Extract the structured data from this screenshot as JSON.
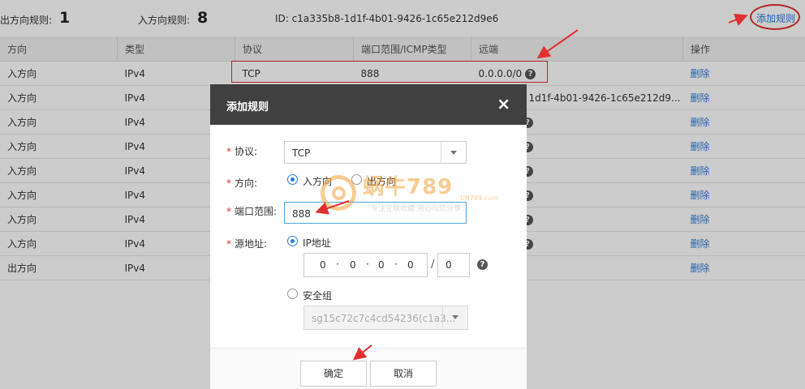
{
  "summary": {
    "outbound_label": "出方向规则:",
    "outbound_count": "1",
    "inbound_label": "入方向规则:",
    "inbound_count": "8",
    "id_text": "ID: c1a335b8-1d1f-4b01-9426-1c65e212d9e6"
  },
  "add_rule_link": "添加规则",
  "table": {
    "headers": [
      "方向",
      "类型",
      "协议",
      "端口范围/ICMP类型",
      "远端",
      "操作"
    ],
    "rows": [
      {
        "direction": "入方向",
        "type": "IPv4",
        "protocol": "TCP",
        "port": "888",
        "remote": "0.0.0.0/0",
        "action": "删除"
      },
      {
        "direction": "入方向",
        "type": "IPv4",
        "remote": "1d1f-4b01-9426-1c65e212d9...",
        "action": "删除"
      },
      {
        "direction": "入方向",
        "type": "IPv4",
        "action": "删除"
      },
      {
        "direction": "入方向",
        "type": "IPv4",
        "action": "删除"
      },
      {
        "direction": "入方向",
        "type": "IPv4",
        "action": "删除"
      },
      {
        "direction": "入方向",
        "type": "IPv4",
        "action": "删除"
      },
      {
        "direction": "入方向",
        "type": "IPv4",
        "action": "删除"
      },
      {
        "direction": "入方向",
        "type": "IPv4",
        "action": "删除"
      },
      {
        "direction": "出方向",
        "type": "IPv4",
        "action": "删除"
      }
    ]
  },
  "modal": {
    "title": "添加规则",
    "close_symbol": "×",
    "protocol_label": "协议:",
    "protocol_value": "TCP",
    "direction_label": "方向:",
    "direction_inbound": "入方向",
    "direction_outbound": "出方向",
    "port_label": "端口范围:",
    "port_value": "888",
    "source_label": "源地址:",
    "source_ip_option": "IP地址",
    "ip_octets": [
      "0",
      "0",
      "0",
      "0"
    ],
    "ip_dot": "·",
    "ip_slash": "/",
    "ip_mask": "0",
    "source_sg_option": "安全组",
    "sg_value": "sg15c72c7c4cd54236(c1a3...",
    "confirm_button": "确定",
    "cancel_button": "取消",
    "required_mark": "*"
  },
  "watermark": {
    "brand": "蜗牛789",
    "site": "UN789.com",
    "slogan": "专注互联收藏    用心与您分享"
  },
  "colors": {
    "accent": "#2b7bd6",
    "annotation_red": "#e23030",
    "header_dark": "#404040"
  }
}
